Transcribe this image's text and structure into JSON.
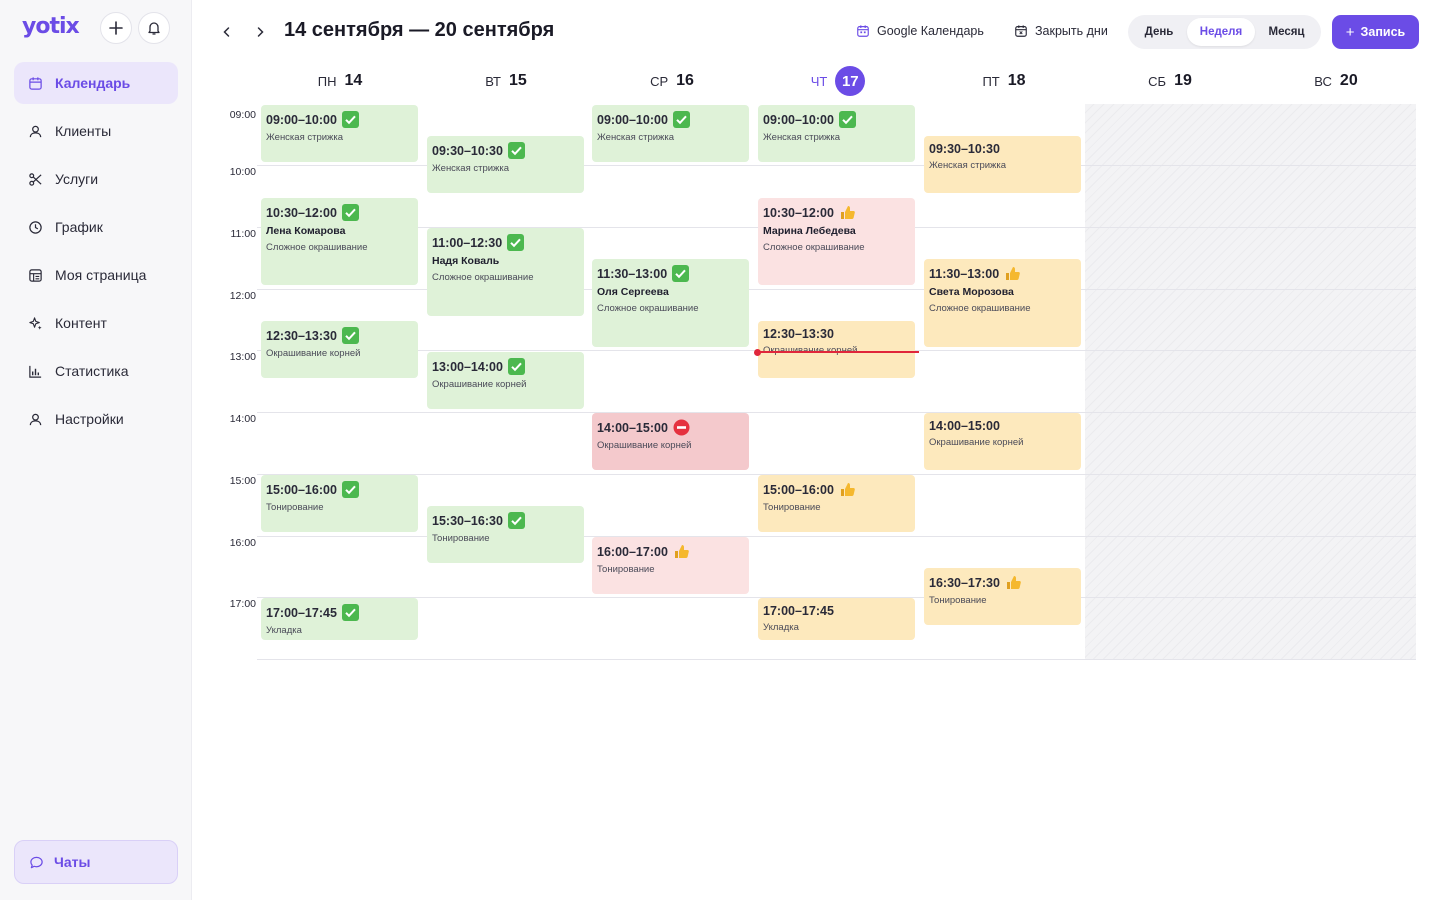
{
  "app": {
    "logo_text": "yotix",
    "accent_color": "#6b4ce6"
  },
  "sidebar": {
    "items": [
      {
        "label": "Календарь",
        "icon": "calendar-icon",
        "active": true
      },
      {
        "label": "Клиенты",
        "icon": "user-icon"
      },
      {
        "label": "Услуги",
        "icon": "scissors-icon"
      },
      {
        "label": "График",
        "icon": "clock-icon"
      },
      {
        "label": "Моя страница",
        "icon": "page-icon"
      },
      {
        "label": "Контент",
        "icon": "sparkle-icon"
      },
      {
        "label": "Статистика",
        "icon": "bar-chart-icon"
      },
      {
        "label": "Настройки",
        "icon": "user-settings-icon"
      }
    ],
    "chats_label": "Чаты"
  },
  "header": {
    "title": "14 сентября — 20 сентября",
    "google_calendar_label": "Google Календарь",
    "close_days_label": "Закрыть дни",
    "views": {
      "day": "День",
      "week": "Неделя",
      "month": "Месяц"
    },
    "active_view": "Неделя",
    "add_label": "Запись"
  },
  "days": [
    {
      "name": "ПН",
      "num": "14"
    },
    {
      "name": "ВТ",
      "num": "15"
    },
    {
      "name": "СР",
      "num": "16"
    },
    {
      "name": "ЧТ",
      "num": "17",
      "today": true
    },
    {
      "name": "ПТ",
      "num": "18"
    },
    {
      "name": "СБ",
      "num": "19"
    },
    {
      "name": "ВС",
      "num": "20"
    }
  ],
  "times": [
    "09:00",
    "10:00",
    "11:00",
    "12:00",
    "13:00",
    "14:00",
    "15:00",
    "16:00",
    "17:00"
  ],
  "status_legend": {
    "confirmed": "check-icon",
    "pending": "thumbs-up-icon",
    "cancelled": "no-entry-icon"
  },
  "events": {
    "mon": [
      {
        "time": "09:00–10:00",
        "client": "",
        "service": "Женская стрижка",
        "status": "confirmed",
        "color": "green"
      },
      {
        "time": "10:30–12:00",
        "client": "Лена Комарова",
        "service": "Сложное окрашивание",
        "status": "confirmed",
        "color": "green"
      },
      {
        "time": "12:30–13:30",
        "client": "",
        "service": "Окрашивание корней",
        "status": "confirmed",
        "color": "green"
      },
      {
        "time": "15:00–16:00",
        "client": "",
        "service": "Тонирование",
        "status": "confirmed",
        "color": "green"
      },
      {
        "time": "17:00–17:45",
        "client": "",
        "service": "Укладка",
        "status": "confirmed",
        "color": "green"
      }
    ],
    "tue": [
      {
        "time": "09:30–10:30",
        "client": "",
        "service": "Женская стрижка",
        "status": "confirmed",
        "color": "green"
      },
      {
        "time": "11:00–12:30",
        "client": "Надя Коваль",
        "service": "Сложное окрашивание",
        "status": "confirmed",
        "color": "green"
      },
      {
        "time": "13:00–14:00",
        "client": "",
        "service": "Окрашивание корней",
        "status": "confirmed",
        "color": "green"
      },
      {
        "time": "15:30–16:30",
        "client": "",
        "service": "Тонирование",
        "status": "confirmed",
        "color": "green"
      }
    ],
    "wed": [
      {
        "time": "09:00–10:00",
        "client": "",
        "service": "Женская стрижка",
        "status": "confirmed",
        "color": "green"
      },
      {
        "time": "11:30–13:00",
        "client": "Оля Сергеева",
        "service": "Сложное окрашивание",
        "status": "confirmed",
        "color": "green"
      },
      {
        "time": "14:00–15:00",
        "client": "",
        "service": "Окрашивание корней",
        "status": "cancelled",
        "color": "red"
      },
      {
        "time": "16:00–17:00",
        "client": "",
        "service": "Тонирование",
        "status": "pending",
        "color": "pink"
      }
    ],
    "thu": [
      {
        "time": "09:00–10:00",
        "client": "",
        "service": "Женская стрижка",
        "status": "confirmed",
        "color": "green"
      },
      {
        "time": "10:30–12:00",
        "client": "Марина Лебедева",
        "service": "Сложное окрашивание",
        "status": "pending",
        "color": "pink"
      },
      {
        "time": "12:30–13:30",
        "client": "",
        "service": "Окрашивание корней",
        "status": "none",
        "color": "yellow"
      },
      {
        "time": "15:00–16:00",
        "client": "",
        "service": "Тонирование",
        "status": "pending",
        "color": "yellow"
      },
      {
        "time": "17:00–17:45",
        "client": "",
        "service": "Укладка",
        "status": "none",
        "color": "yellow"
      }
    ],
    "fri": [
      {
        "time": "09:30–10:30",
        "client": "",
        "service": "Женская стрижка",
        "status": "none",
        "color": "yellow"
      },
      {
        "time": "11:30–13:00",
        "client": "Света Морозова",
        "service": "Сложное окрашивание",
        "status": "pending",
        "color": "yellow"
      },
      {
        "time": "14:00–15:00",
        "client": "",
        "service": "Окрашивание корней",
        "status": "none",
        "color": "yellow"
      },
      {
        "time": "16:30–17:30",
        "client": "",
        "service": "Тонирование",
        "status": "pending",
        "color": "yellow"
      }
    ]
  },
  "colors": {
    "green": "#dff2d8",
    "yellow": "#fde9bd",
    "pink": "#fbe2e2",
    "red": "#f4c9cc",
    "now_line": "#e0263b"
  }
}
